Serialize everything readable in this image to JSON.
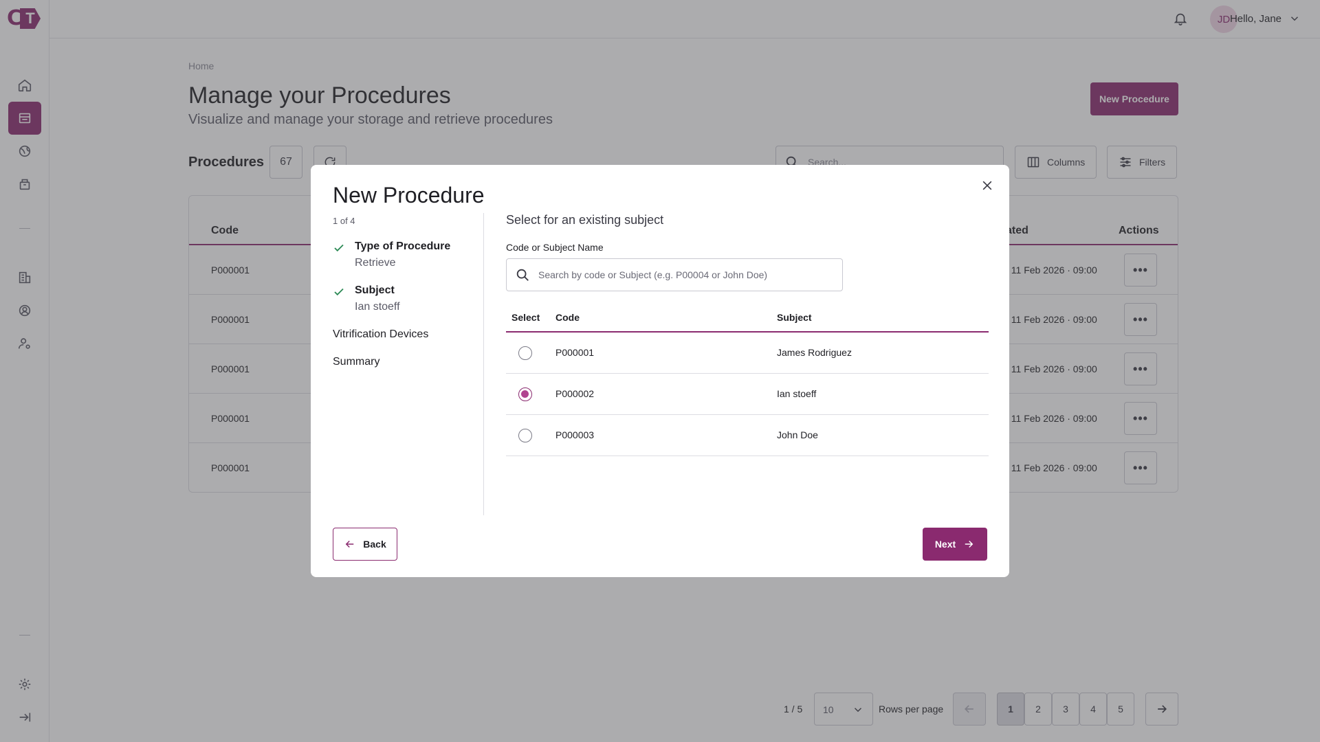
{
  "brand": {
    "logo_c": "C",
    "logo_t": "T",
    "accent": "#8a2a6f"
  },
  "sidebar": {
    "items": [
      {
        "icon": "home-icon"
      },
      {
        "icon": "procedures-icon",
        "active": true
      },
      {
        "icon": "globe-icon"
      },
      {
        "icon": "archive-icon"
      },
      {
        "icon": "building-icon"
      },
      {
        "icon": "user-circle-icon"
      },
      {
        "icon": "user-settings-icon"
      },
      {
        "icon": "settings-icon"
      },
      {
        "icon": "collapse-icon"
      }
    ]
  },
  "topbar": {
    "avatar_initials": "JD",
    "greeting": "Hello, Jane"
  },
  "page": {
    "breadcrumb": "Home",
    "title": "Manage your Procedures",
    "subtitle": "Visualize and manage your storage and retrieve procedures",
    "new_button": "New Procedure",
    "section_title": "Procedures",
    "count": "67",
    "search_placeholder": "Search...",
    "columns_button": "Columns",
    "filters_button": "Filters"
  },
  "table": {
    "headers": {
      "code": "Code",
      "created": "ated",
      "actions": "Actions"
    },
    "rows": [
      {
        "code": "P000001",
        "date": ", 11 Feb 2026 · 09:00"
      },
      {
        "code": "P000001",
        "date": ", 11 Feb 2026 · 09:00"
      },
      {
        "code": "P000001",
        "date": ", 11 Feb 2026 · 09:00"
      },
      {
        "code": "P000001",
        "date": ", 11 Feb 2026 · 09:00"
      },
      {
        "code": "P000001",
        "date": ", 11 Feb 2026 · 09:00"
      }
    ],
    "more_label": "•••"
  },
  "pagination": {
    "page_info": "1 / 5",
    "rows_value": "10",
    "rows_label": "Rows per page",
    "pages": [
      "1",
      "2",
      "3",
      "4",
      "5"
    ],
    "current": "1"
  },
  "modal": {
    "title": "New Procedure",
    "step_count": "1 of 4",
    "steps": [
      {
        "title": "Type of Procedure",
        "value": "Retrieve",
        "done": true
      },
      {
        "title": "Subject",
        "value": "Ian stoeff",
        "done": true
      },
      {
        "title": "Vitrification Devices"
      },
      {
        "title": "Summary"
      }
    ],
    "section_heading": "Select for an existing subject",
    "field_label": "Code or Subject Name",
    "field_placeholder": "Search by code or Subject (e.g. P00004 or John Doe)",
    "table_headers": {
      "select": "Select",
      "code": "Code",
      "subject": "Subject"
    },
    "rows": [
      {
        "code": "P000001",
        "subject": "James Rodriguez",
        "selected": false
      },
      {
        "code": "P000002",
        "subject": "Ian stoeff",
        "selected": true
      },
      {
        "code": "P000003",
        "subject": "John Doe",
        "selected": false
      }
    ],
    "back_button": "Back",
    "next_button": "Next"
  }
}
